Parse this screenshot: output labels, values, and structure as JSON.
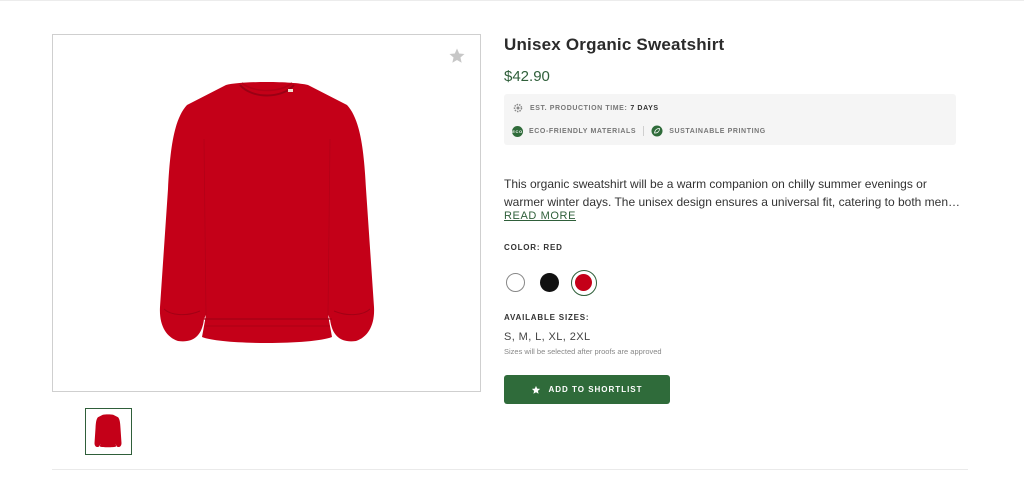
{
  "product": {
    "title": "Unisex Organic Sweatshirt",
    "price": "$42.90",
    "description": "This organic sweatshirt will be a warm companion on chilly summer evenings or warmer winter days. The unisex design ensures a universal fit, catering to both men…",
    "read_more": "READ MORE"
  },
  "info": {
    "production_label": "EST. PRODUCTION TIME:",
    "production_value": "7 DAYS",
    "eco_badge": "ECO",
    "eco_label": "ECO-FRIENDLY MATERIALS",
    "printing_label": "SUSTAINABLE PRINTING"
  },
  "color": {
    "label": "COLOR: RED",
    "options": [
      {
        "name": "White",
        "hex": "#ffffff"
      },
      {
        "name": "Black",
        "hex": "#111111"
      },
      {
        "name": "Red",
        "hex": "#c40018",
        "selected": true
      }
    ]
  },
  "sizes": {
    "label": "AVAILABLE SIZES:",
    "value": "S, M, L, XL, 2XL",
    "note": "Sizes will be selected after proofs are approved"
  },
  "actions": {
    "shortlist_label": "ADD TO SHORTLIST"
  },
  "gallery": {
    "main_image": "red-sweatshirt",
    "favorite_icon": "star-icon",
    "thumbnails": [
      "red-sweatshirt-thumb"
    ]
  },
  "colors": {
    "accent": "#2f6b3a",
    "price": "#2f5f3a",
    "product_red": "#c40018"
  }
}
